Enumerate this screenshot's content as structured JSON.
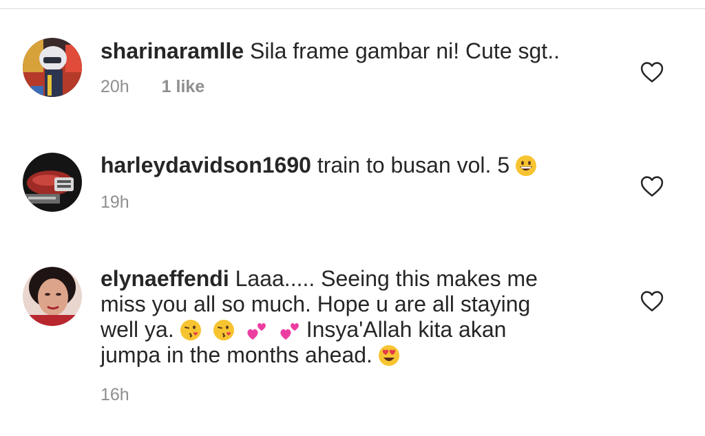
{
  "comments": [
    {
      "username": "sharinaramlle",
      "text": "Sila frame gambar ni! Cute sgt..",
      "time": "20h",
      "likes": "1 like",
      "avatar_icon": "helmet-rider-avatar"
    },
    {
      "username": "harleydavidson1690",
      "text_before": "train to busan vol. 5",
      "emoji": "grinning-face-icon",
      "time": "19h",
      "avatar_icon": "motorcycle-avatar"
    },
    {
      "username": "elynaeffendi",
      "line1": "Laaa..... Seeing this makes me",
      "line2": "miss you all so much. Hope u are all staying",
      "line3_a": "well ya.",
      "line3_b": "Insya'Allah kita akan",
      "line4": "jumpa in the months ahead.",
      "emojis": [
        "face-blowing-kiss-icon",
        "face-blowing-kiss-icon",
        "two-hearts-icon",
        "two-hearts-icon",
        "heart-eyes-icon"
      ],
      "time": "16h",
      "avatar_icon": "woman-portrait-avatar"
    }
  ],
  "colors": {
    "text": "#262626",
    "secondary": "#8e8e8e",
    "divider": "#dbdbdb"
  }
}
